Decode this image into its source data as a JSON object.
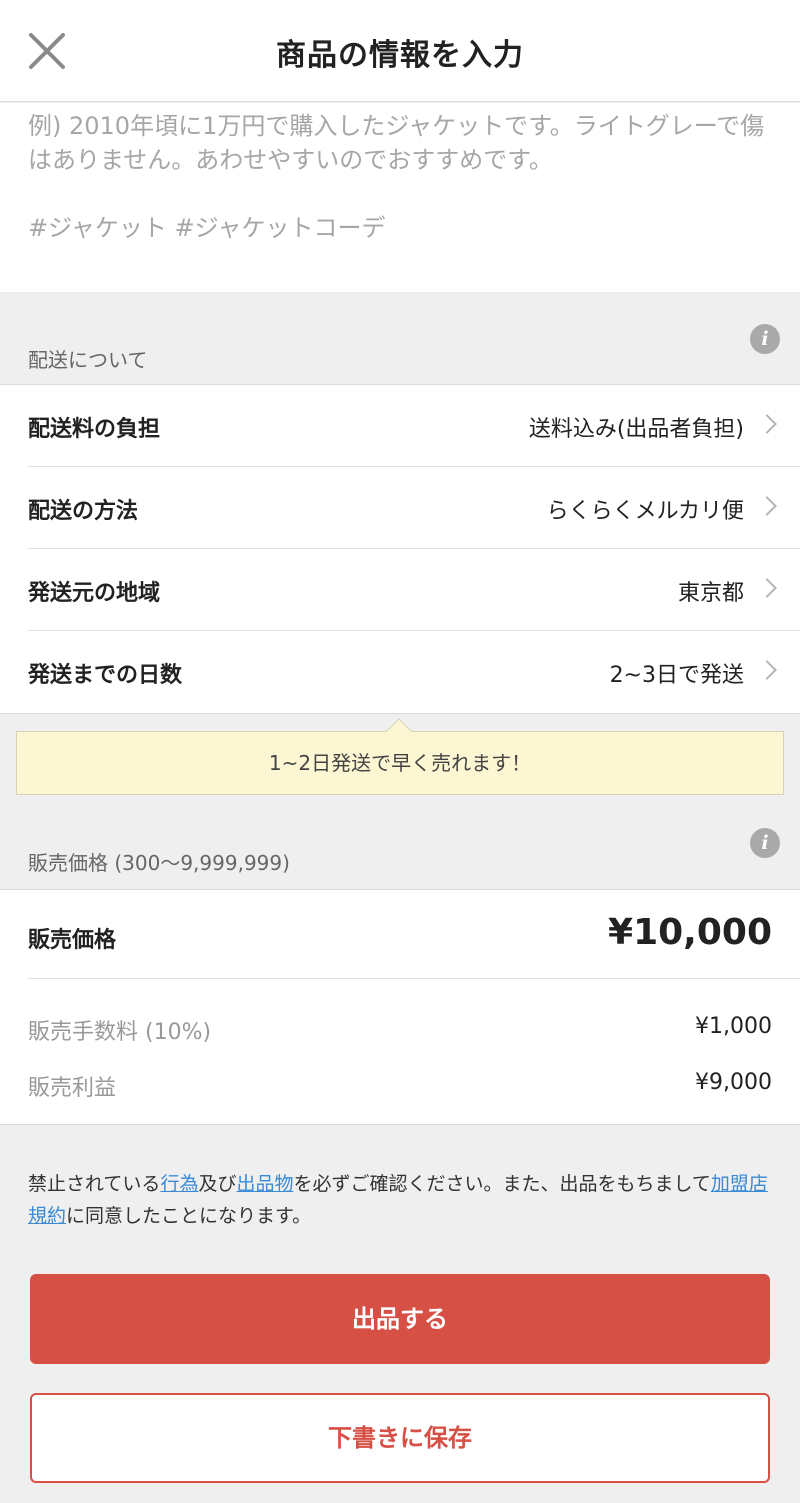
{
  "header": {
    "title": "商品の情報を入力",
    "close_icon": "close-icon"
  },
  "description": {
    "placeholder": "例) 2010年頃に1万円で購入したジャケットです。ライトグレーで傷はありません。あわせやすいのでおすすめです。\n\n#ジャケット #ジャケットコーデ"
  },
  "shipping": {
    "section_title": "配送について",
    "rows": [
      {
        "label": "配送料の負担",
        "value": "送料込み(出品者負担)"
      },
      {
        "label": "配送の方法",
        "value": "らくらくメルカリ便"
      },
      {
        "label": "発送元の地域",
        "value": "東京都"
      },
      {
        "label": "発送までの日数",
        "value": "2~3日で発送"
      }
    ],
    "tip": "1~2日発送で早く売れます！"
  },
  "price": {
    "section_title": "販売価格 (300〜9,999,999)",
    "label": "販売価格",
    "value": "¥10,000",
    "fee_label": "販売手数料 (10%)",
    "fee_value": "¥1,000",
    "profit_label": "販売利益",
    "profit_value": "¥9,000"
  },
  "terms": {
    "part1": "禁止されている",
    "link1": "行為",
    "part2": "及び",
    "link2": "出品物",
    "part3": "を必ずご確認ください。また、出品をもちまして",
    "link3": "加盟店規約",
    "part4": "に同意したことになります。"
  },
  "buttons": {
    "submit": "出品する",
    "save_draft": "下書きに保存"
  },
  "colors": {
    "accent": "#d65046",
    "link": "#3a8ad6",
    "tip_bg": "#fcf6d2"
  }
}
